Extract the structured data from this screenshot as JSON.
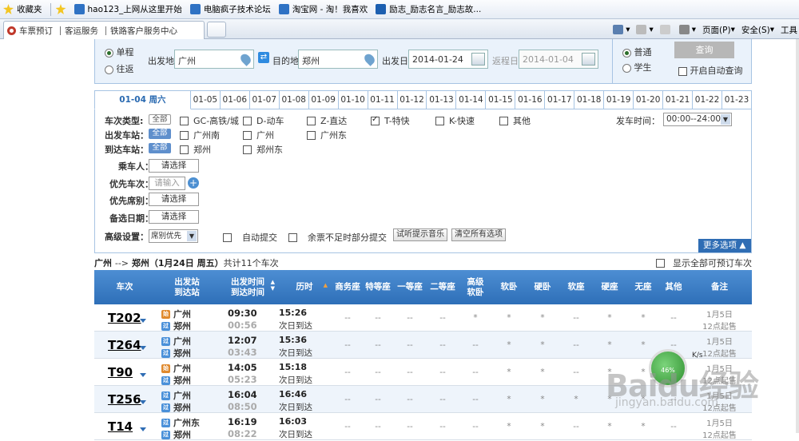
{
  "favorites": {
    "label": "收藏夹",
    "items": [
      "hao123_上网从这里开始",
      "电脑疯子技术论坛",
      "淘宝网 - 淘！我喜欢",
      "励志_励志名言_励志故..."
    ]
  },
  "tabs": {
    "items": [
      "车票预订",
      "客运服务",
      "铁路客户服务中心"
    ]
  },
  "commandbar": {
    "page": "页面(P)",
    "safety": "安全(S)",
    "tools": "工具"
  },
  "search": {
    "single": "单程",
    "round": "往返",
    "from_label": "出发地",
    "from_value": "广州",
    "to_label": "目的地",
    "to_value": "郑州",
    "depart_label": "出发日",
    "depart_value": "2014-01-24",
    "return_label": "返程日",
    "return_value": "2014-01-04",
    "normal": "普通",
    "student": "学生",
    "query_button": "查询",
    "auto_query": "开启自动查询"
  },
  "date_tabs": [
    "01-04 周六",
    "01-05",
    "01-06",
    "01-07",
    "01-08",
    "01-09",
    "01-10",
    "01-11",
    "01-12",
    "01-13",
    "01-14",
    "01-15",
    "01-16",
    "01-17",
    "01-18",
    "01-19",
    "01-20",
    "01-21",
    "01-22",
    "01-23"
  ],
  "filters": {
    "type_label": "车次类型:",
    "type_all": "全部",
    "types": [
      {
        "label": "GC-高铁/城",
        "checked": false
      },
      {
        "label": "D-动车",
        "checked": false
      },
      {
        "label": "Z-直达",
        "checked": false
      },
      {
        "label": "T-特快",
        "checked": true
      },
      {
        "label": "K-快速",
        "checked": false
      },
      {
        "label": "其他",
        "checked": false
      }
    ],
    "depart_time_label": "发车时间：",
    "depart_time_value": "00:00--24:00",
    "from_station_label": "出发车站：",
    "from_all": "全部",
    "from_stations": [
      "广州南",
      "广州",
      "广州东"
    ],
    "to_station_label": "到达车站：",
    "to_all": "全部",
    "to_stations": [
      "郑州",
      "郑州东"
    ],
    "passenger_label": "乘车人：",
    "passenger_value": "请选择",
    "pref_train_label": "优先车次：",
    "pref_train_placeholder": "请输入",
    "pref_seat_label": "优先席别：",
    "pref_seat_value": "请选择",
    "alt_date_label": "备选日期：",
    "alt_date_value": "请选择",
    "advanced_label": "高级设置：",
    "advanced_value": "席别优先",
    "auto_submit": "自动提交",
    "partial_submit": "余票不足时部分提交",
    "test_music": "试听提示音乐",
    "clear_all": "清空所有选项",
    "more_options": "更多选项"
  },
  "route": {
    "from": "广州",
    "arrow": "-->",
    "to": "郑州",
    "date": "（1月24日  周五）",
    "count": "共计11个车次",
    "show_all": "显示全部可预订车次"
  },
  "table": {
    "headers": [
      "车次",
      "出发站\n到达站",
      "出发时间\n到达时间",
      "历时",
      "商务座",
      "特等座",
      "一等座",
      "二等座",
      "高级\n软卧",
      "软卧",
      "硬卧",
      "软座",
      "硬座",
      "无座",
      "其他",
      "备注"
    ],
    "rows": [
      {
        "train": "T202",
        "from": "广州",
        "to": "郑州",
        "dep": "09:30",
        "arr": "00:56",
        "dur": "15:26",
        "day": "次日到达",
        "seats": [
          "--",
          "--",
          "--",
          "--",
          "*",
          "*",
          "*",
          "--",
          "*",
          "*",
          "--"
        ],
        "note1": "1月5日",
        "note2": "12点起售",
        "from_badge": "始",
        "to_badge": "过"
      },
      {
        "train": "T264",
        "from": "广州",
        "to": "郑州",
        "dep": "12:07",
        "arr": "03:43",
        "dur": "15:36",
        "day": "次日到达",
        "seats": [
          "--",
          "--",
          "--",
          "--",
          "--",
          "*",
          "*",
          "--",
          "*",
          "*",
          "--"
        ],
        "note1": "1月5日",
        "note2": "12点起售",
        "from_badge": "过",
        "to_badge": "过"
      },
      {
        "train": "T90",
        "from": "广州",
        "to": "郑州",
        "dep": "14:05",
        "arr": "05:23",
        "dur": "15:18",
        "day": "次日到达",
        "seats": [
          "--",
          "--",
          "--",
          "--",
          "--",
          "*",
          "*",
          "--",
          "*",
          "*",
          "--"
        ],
        "note1": "1月5日",
        "note2": "12点起售",
        "from_badge": "始",
        "to_badge": "过"
      },
      {
        "train": "T256",
        "from": "广州",
        "to": "郑州",
        "dep": "16:04",
        "arr": "08:50",
        "dur": "16:46",
        "day": "次日到达",
        "seats": [
          "--",
          "--",
          "--",
          "--",
          "--",
          "*",
          "*",
          "*",
          "*",
          "*",
          "--"
        ],
        "note1": "1月5日",
        "note2": "12点起售",
        "from_badge": "过",
        "to_badge": "过"
      },
      {
        "train": "T14",
        "from": "广州东",
        "to": "郑州",
        "dep": "16:19",
        "arr": "08:22",
        "dur": "16:03",
        "day": "次日到达",
        "seats": [
          "--",
          "--",
          "--",
          "--",
          "--",
          "*",
          "*",
          "--",
          "*",
          "*",
          "--"
        ],
        "note1": "1月5日",
        "note2": "12点起售",
        "from_badge": "过",
        "to_badge": "过"
      }
    ]
  },
  "widget": {
    "percent": "46%",
    "speed": "K/s"
  },
  "watermark": {
    "text": "Baidu经验",
    "url": "jingyan.baidu.com"
  },
  "colors": {
    "header_blue": "#2e6fb8",
    "accent": "#2f6db4",
    "panel_bg": "#eaf2fb"
  }
}
